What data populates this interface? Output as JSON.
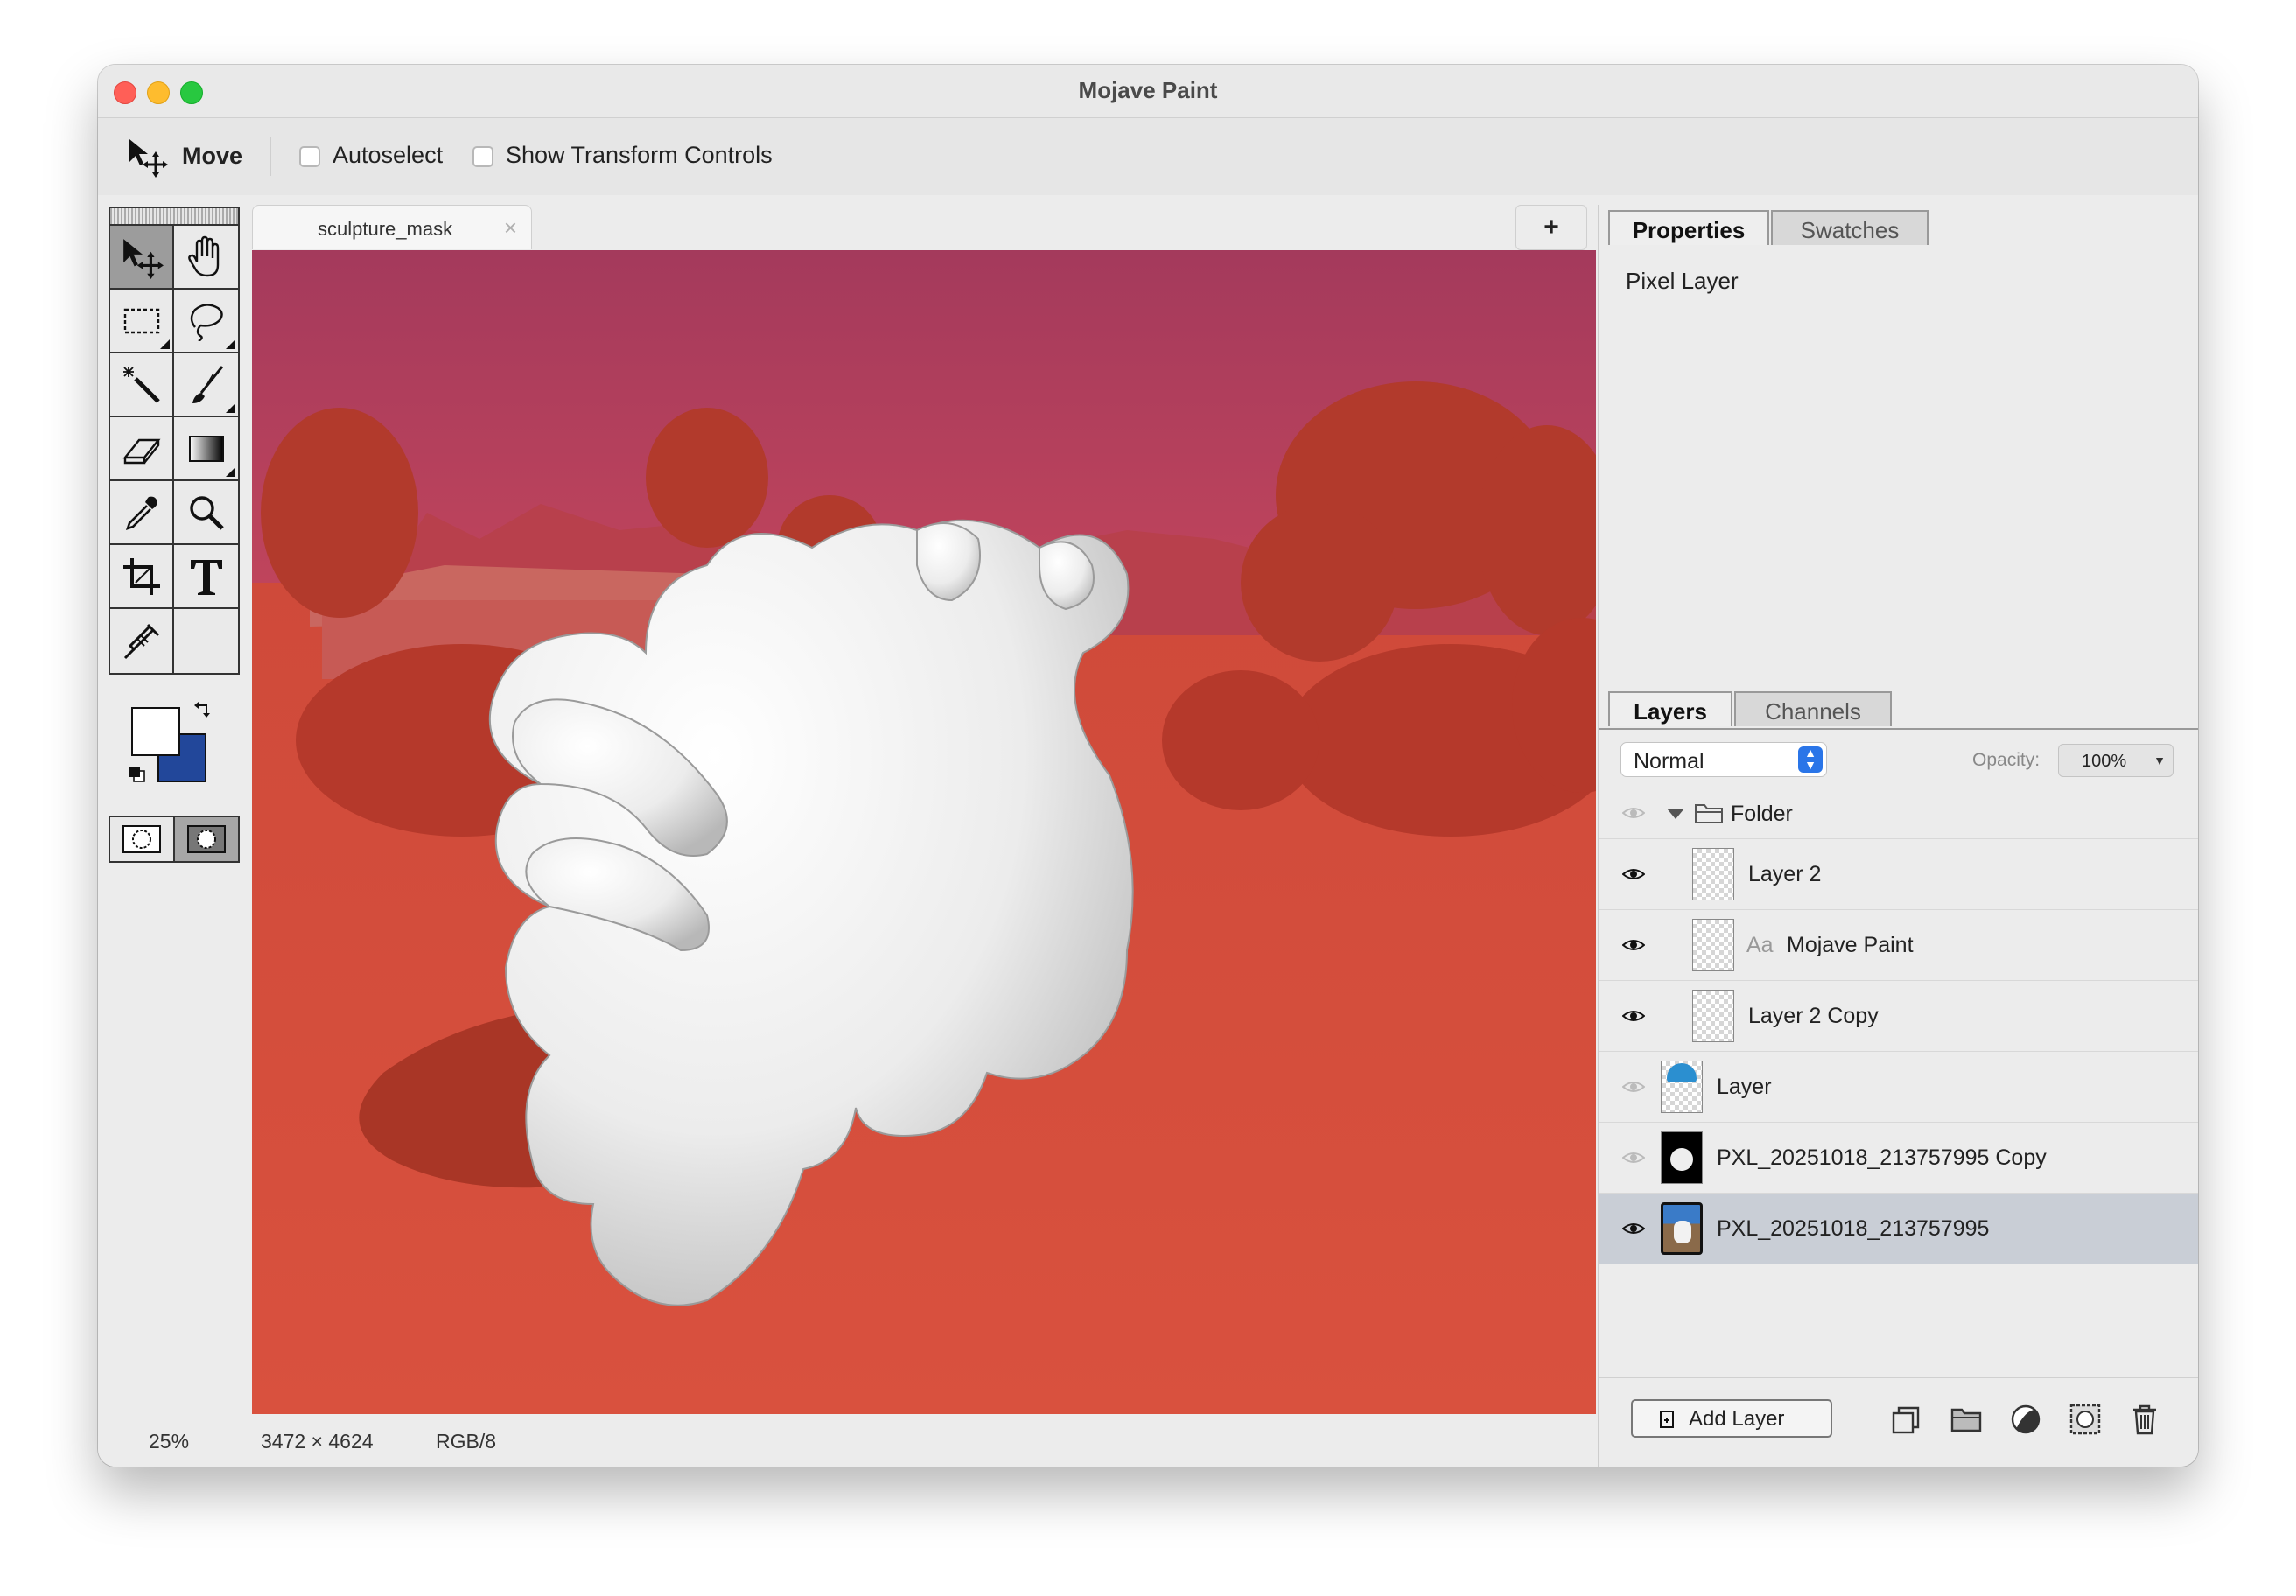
{
  "window": {
    "title": "Mojave Paint"
  },
  "toolbar": {
    "tool_name": "Move",
    "autoselect": {
      "label": "Autoselect",
      "checked": false
    },
    "show_transform": {
      "label": "Show Transform Controls",
      "checked": false
    }
  },
  "tools": [
    {
      "name": "move-tool",
      "icon": "move-arrow-icon",
      "active": true
    },
    {
      "name": "hand-tool",
      "icon": "hand-icon"
    },
    {
      "name": "marquee-tool",
      "icon": "rect-marquee-icon"
    },
    {
      "name": "lasso-tool",
      "icon": "lasso-icon"
    },
    {
      "name": "magic-wand-tool",
      "icon": "magic-wand-icon"
    },
    {
      "name": "brush-tool",
      "icon": "brush-icon"
    },
    {
      "name": "eraser-tool",
      "icon": "eraser-icon"
    },
    {
      "name": "gradient-tool",
      "icon": "gradient-icon"
    },
    {
      "name": "eyedropper-tool",
      "icon": "eyedropper-icon"
    },
    {
      "name": "zoom-tool",
      "icon": "magnifier-icon"
    },
    {
      "name": "crop-tool",
      "icon": "crop-icon"
    },
    {
      "name": "text-tool",
      "icon": "text-T-icon"
    },
    {
      "name": "clone-stamp-tool",
      "icon": "syringe-icon"
    }
  ],
  "colors": {
    "foreground": "#ffffff",
    "background": "#22479a"
  },
  "document": {
    "tab_label": "sculpture_mask",
    "close_glyph": "×",
    "new_tab_glyph": "+",
    "mask_overlay_color": "#d64b3a"
  },
  "status": {
    "zoom": "25%",
    "dimensions": "3472 × 4624",
    "mode": "RGB/8"
  },
  "properties_panel": {
    "tabs": [
      "Properties",
      "Swatches"
    ],
    "active_tab": "Properties",
    "content": "Pixel Layer"
  },
  "layers_panel": {
    "tabs": [
      "Layers",
      "Channels"
    ],
    "active_tab": "Layers",
    "blend_mode": "Normal",
    "opacity_label": "Opacity:",
    "opacity_value": "100%",
    "layers": [
      {
        "name": "Folder",
        "type": "folder",
        "visible": false,
        "expanded": true
      },
      {
        "name": "Layer 2",
        "type": "pixel",
        "visible": true,
        "indent": 1
      },
      {
        "name": "Mojave Paint",
        "type": "text",
        "type_mark": "Aa",
        "visible": true,
        "indent": 1
      },
      {
        "name": "Layer 2 Copy",
        "type": "pixel",
        "visible": true,
        "indent": 1
      },
      {
        "name": "Layer",
        "type": "pixel",
        "visible": false,
        "indent": 0
      },
      {
        "name": "PXL_20251018_213757995 Copy",
        "type": "pixel",
        "visible": false,
        "indent": 0
      },
      {
        "name": "PXL_20251018_213757995",
        "type": "pixel",
        "visible": true,
        "indent": 0,
        "selected": true
      }
    ],
    "add_layer_label": "Add Layer"
  }
}
